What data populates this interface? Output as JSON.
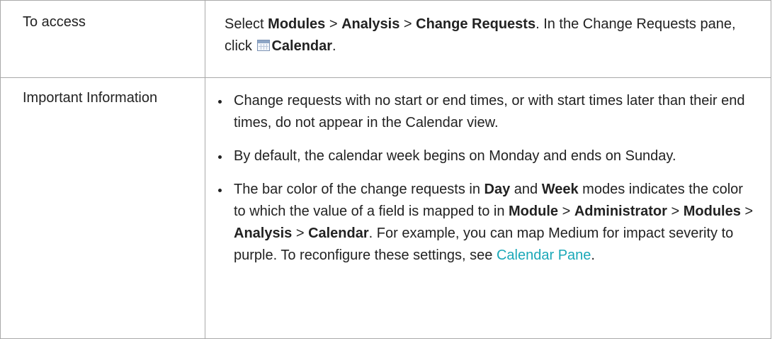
{
  "table": {
    "rows": [
      {
        "label": "To access",
        "content": {
          "t1": "Select ",
          "b1": "Modules",
          "t2": " > ",
          "b2": "Analysis",
          "t3": " > ",
          "b3": "Change Requests",
          "t4": ". In the Change Requests pane, click ",
          "icon": "calendar-icon",
          "b4": "Calendar",
          "t5": "."
        }
      },
      {
        "label": "Important Information",
        "bullets": [
          {
            "text": "Change requests with no start or end times, or with start times later than their end times, do not appear in the Calendar view."
          },
          {
            "text": "By default, the calendar week begins on Monday and ends on Sunday."
          },
          {
            "t1": "The bar color of the change requests in ",
            "b1": "Day",
            "t2": " and ",
            "b2": "Week",
            "t3": " modes indicates the color to which the value of a field is mapped to in ",
            "b3": "Module",
            "t4": " > ",
            "b4": "Administrator",
            "t5": " > ",
            "b5": "Modules",
            "t6": " > ",
            "b6": "Analysis",
            "t7": " > ",
            "b7": "Calendar",
            "t8": ". For example, you can map Medium for impact severity to purple. To reconfigure these settings, see ",
            "link": "Calendar Pane",
            "t9": "."
          }
        ]
      }
    ]
  },
  "colors": {
    "text": "#222222",
    "border": "#a9a9a9",
    "link": "#1aa8b8"
  }
}
